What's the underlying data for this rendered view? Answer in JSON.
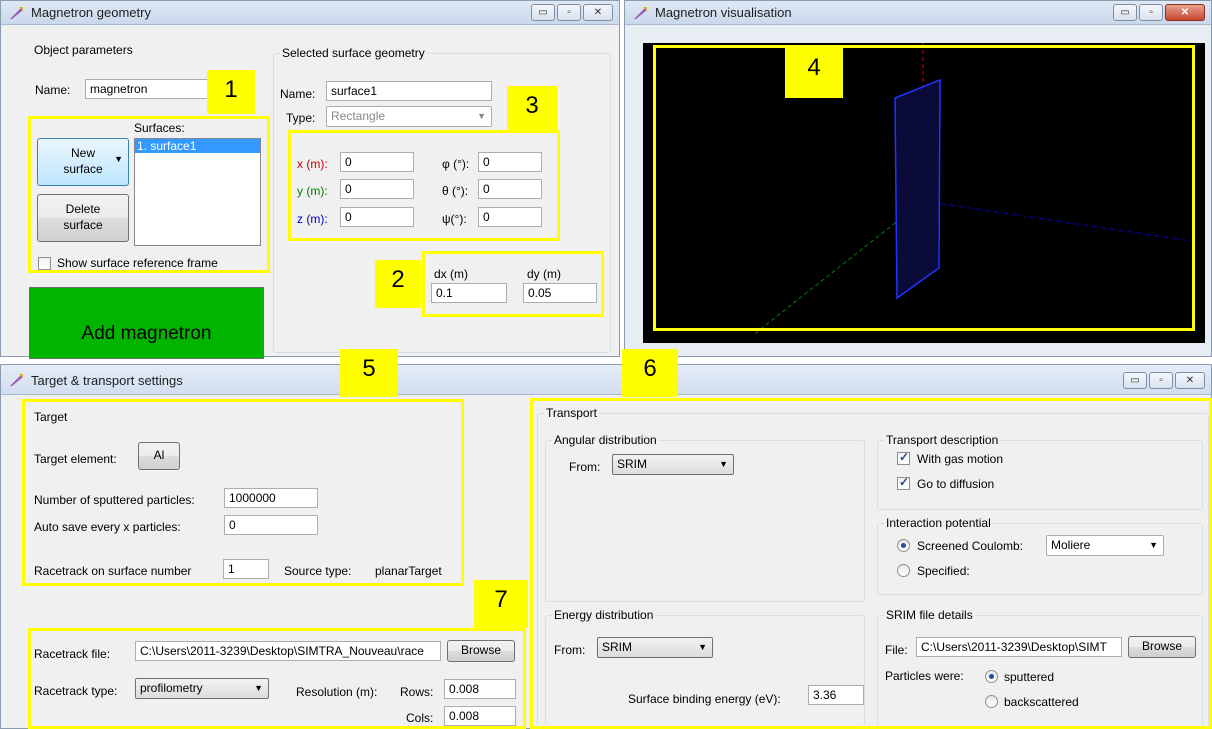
{
  "geometry_window": {
    "title": "Magnetron geometry",
    "object_parameters": {
      "group_label": "Object parameters",
      "name_label": "Name:",
      "name_value": "magnetron",
      "surfaces_label": "Surfaces:",
      "new_surface_label": "New surface",
      "delete_surface_label": "Delete surface",
      "surfaces": [
        "1. surface1"
      ],
      "show_frame_label": "Show surface reference frame",
      "add_magnetron_label": "Add magnetron"
    },
    "selected_surface": {
      "group_label": "Selected surface geometry",
      "name_label": "Name:",
      "name_value": "surface1",
      "type_label": "Type:",
      "type_value": "Rectangle",
      "x_label": "x (m):",
      "x_value": "0",
      "y_label": "y (m):",
      "y_value": "0",
      "z_label": "z (m):",
      "z_value": "0",
      "phi_label": "φ (°):",
      "phi_value": "0",
      "theta_label": "θ (°):",
      "theta_value": "0",
      "psi_label": "ψ(°):",
      "psi_value": "0",
      "dx_label": "dx (m)",
      "dx_value": "0.1",
      "dy_label": "dy (m)",
      "dy_value": "0.05"
    }
  },
  "visual_window": {
    "title": "Magnetron visualisation"
  },
  "target_window": {
    "title": "Target & transport settings",
    "target": {
      "group_label": "Target",
      "element_label": "Target element:",
      "element_value": "Al",
      "num_particles_label": "Number of sputtered particles:",
      "num_particles_value": "1000000",
      "autosave_label": "Auto save every x particles:",
      "autosave_value": "0",
      "racetrack_surface_label": "Racetrack on surface number",
      "racetrack_surface_value": "1",
      "source_type_label": "Source type:",
      "source_type_value": "planarTarget",
      "racetrack_file_label": "Racetrack file:",
      "racetrack_file_value": "C:\\Users\\2011-3239\\Desktop\\SIMTRA_Nouveau\\race",
      "browse_label": "Browse",
      "racetrack_type_label": "Racetrack type:",
      "racetrack_type_value": "profilometry",
      "resolution_label": "Resolution (m):",
      "rows_label": "Rows:",
      "rows_value": "0.008",
      "cols_label": "Cols:",
      "cols_value": "0.008"
    },
    "transport": {
      "group_label": "Transport",
      "angular_label": "Angular distribution",
      "angular_from_label": "From:",
      "angular_from_value": "SRIM",
      "energy_label": "Energy distribution",
      "energy_from_label": "From:",
      "energy_from_value": "SRIM",
      "binding_energy_label": "Surface binding energy (eV):",
      "binding_energy_value": "3.36",
      "description_label": "Transport description",
      "gas_motion_label": "With gas motion",
      "diffusion_label": "Go to diffusion",
      "potential_label": "Interaction potential",
      "screened_label": "Screened Coulomb:",
      "screened_value": "Moliere",
      "specified_label": "Specified:",
      "srim_label": "SRIM file details",
      "file_label": "File:",
      "file_value": "C:\\Users\\2011-3239\\Desktop\\SIMT",
      "browse_label": "Browse",
      "particles_were_label": "Particles were:",
      "sputtered_label": "sputtered",
      "backscattered_label": "backscattered"
    }
  },
  "callouts": [
    "1",
    "2",
    "3",
    "4",
    "5",
    "6",
    "7"
  ],
  "colors": {
    "highlight": "#ffff00",
    "add_button": "#00b400",
    "viz_bg": "#000000",
    "x_axis_color": "#cc0000",
    "y_axis_color": "#008000",
    "z_axis_color": "#0000cc"
  }
}
